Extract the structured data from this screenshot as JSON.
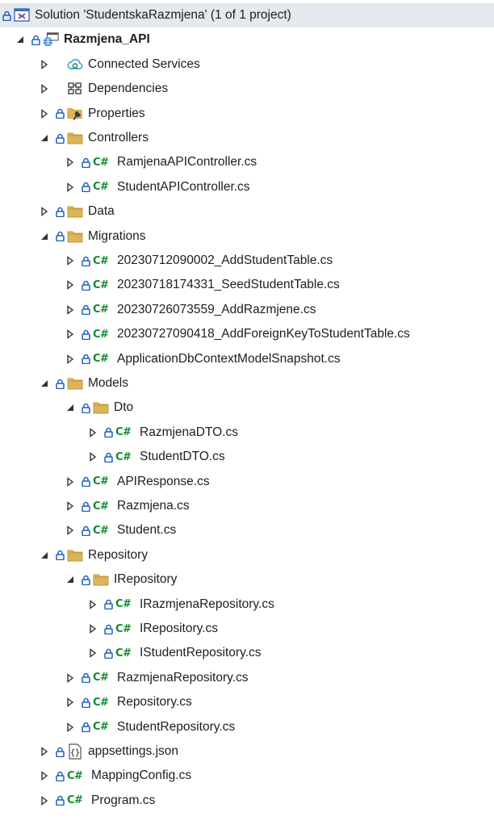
{
  "panel": "Solution Explorer",
  "colors": {
    "folder_fill": "#dcb45a",
    "folder_tab": "#c59a3d",
    "csharp_icon": "#128a2e",
    "lock_icon": "#1f5fbf",
    "expander": "#333333",
    "solution_row_bg": "#e5e8ee"
  },
  "tree": [
    {
      "label": "Solution 'StudentskaRazmjena' (1 of 1 project)",
      "icon": "solution-icon",
      "expander": "none",
      "lock": true,
      "level": 0,
      "selected": true
    },
    {
      "label": "Razmjena_API",
      "icon": "web-project-icon",
      "expander": "expanded",
      "lock": true,
      "level": 1,
      "bold": true
    },
    {
      "label": "Connected Services",
      "icon": "connected-services-icon",
      "expander": "collapsed",
      "lock": false,
      "level": 2
    },
    {
      "label": "Dependencies",
      "icon": "dependencies-icon",
      "expander": "collapsed",
      "lock": false,
      "level": 2
    },
    {
      "label": "Properties",
      "icon": "properties-folder-icon",
      "expander": "collapsed",
      "lock": true,
      "level": 2
    },
    {
      "label": "Controllers",
      "icon": "folder-icon",
      "expander": "expanded",
      "lock": true,
      "level": 2
    },
    {
      "label": "RamjenaAPIController.cs",
      "icon": "csharp-icon",
      "expander": "collapsed",
      "lock": true,
      "level": 3
    },
    {
      "label": "StudentAPIController.cs",
      "icon": "csharp-icon",
      "expander": "collapsed",
      "lock": true,
      "level": 3
    },
    {
      "label": "Data",
      "icon": "folder-icon",
      "expander": "collapsed",
      "lock": true,
      "level": 2
    },
    {
      "label": "Migrations",
      "icon": "folder-icon",
      "expander": "expanded",
      "lock": true,
      "level": 2
    },
    {
      "label": "20230712090002_AddStudentTable.cs",
      "icon": "csharp-icon",
      "expander": "collapsed",
      "lock": true,
      "level": 3
    },
    {
      "label": "20230718174331_SeedStudentTable.cs",
      "icon": "csharp-icon",
      "expander": "collapsed",
      "lock": true,
      "level": 3
    },
    {
      "label": "20230726073559_AddRazmjene.cs",
      "icon": "csharp-icon",
      "expander": "collapsed",
      "lock": true,
      "level": 3
    },
    {
      "label": "20230727090418_AddForeignKeyToStudentTable.cs",
      "icon": "csharp-icon",
      "expander": "collapsed",
      "lock": true,
      "level": 3
    },
    {
      "label": "ApplicationDbContextModelSnapshot.cs",
      "icon": "csharp-icon",
      "expander": "collapsed",
      "lock": true,
      "level": 3
    },
    {
      "label": "Models",
      "icon": "folder-icon",
      "expander": "expanded",
      "lock": true,
      "level": 2
    },
    {
      "label": "Dto",
      "icon": "folder-icon",
      "expander": "expanded",
      "lock": true,
      "level": 3
    },
    {
      "label": "RazmjenaDTO.cs",
      "icon": "csharp-icon",
      "expander": "collapsed",
      "lock": true,
      "level": 4
    },
    {
      "label": "StudentDTO.cs",
      "icon": "csharp-icon",
      "expander": "collapsed",
      "lock": true,
      "level": 4
    },
    {
      "label": "APIResponse.cs",
      "icon": "csharp-icon",
      "expander": "collapsed",
      "lock": true,
      "level": 3
    },
    {
      "label": "Razmjena.cs",
      "icon": "csharp-icon",
      "expander": "collapsed",
      "lock": true,
      "level": 3
    },
    {
      "label": "Student.cs",
      "icon": "csharp-icon",
      "expander": "collapsed",
      "lock": true,
      "level": 3
    },
    {
      "label": "Repository",
      "icon": "folder-icon",
      "expander": "expanded",
      "lock": true,
      "level": 2
    },
    {
      "label": "IRepository",
      "icon": "folder-icon",
      "expander": "expanded",
      "lock": true,
      "level": 3
    },
    {
      "label": "IRazmjenaRepository.cs",
      "icon": "csharp-icon",
      "expander": "collapsed",
      "lock": true,
      "level": 4
    },
    {
      "label": "IRepository.cs",
      "icon": "csharp-icon",
      "expander": "collapsed",
      "lock": true,
      "level": 4
    },
    {
      "label": "IStudentRepository.cs",
      "icon": "csharp-icon",
      "expander": "collapsed",
      "lock": true,
      "level": 4
    },
    {
      "label": "RazmjenaRepository.cs",
      "icon": "csharp-icon",
      "expander": "collapsed",
      "lock": true,
      "level": 3
    },
    {
      "label": "Repository.cs",
      "icon": "csharp-icon",
      "expander": "collapsed",
      "lock": true,
      "level": 3
    },
    {
      "label": "StudentRepository.cs",
      "icon": "csharp-icon",
      "expander": "collapsed",
      "lock": true,
      "level": 3
    },
    {
      "label": "appsettings.json",
      "icon": "json-file-icon",
      "expander": "collapsed",
      "lock": true,
      "level": 2
    },
    {
      "label": "MappingConfig.cs",
      "icon": "csharp-icon",
      "expander": "collapsed",
      "lock": true,
      "level": 2
    },
    {
      "label": "Program.cs",
      "icon": "csharp-icon",
      "expander": "collapsed",
      "lock": true,
      "level": 2
    }
  ]
}
